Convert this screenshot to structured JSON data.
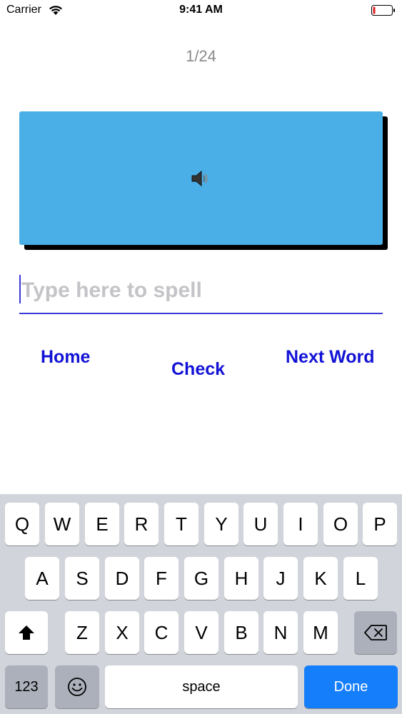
{
  "status_bar": {
    "carrier": "Carrier",
    "time": "9:41 AM",
    "wifi_icon": "wifi-icon",
    "battery_icon": "battery-icon"
  },
  "counter": "1/24",
  "sound_card": {
    "icon": "speaker-icon",
    "color": "#4aafe6"
  },
  "spell_input": {
    "value": "",
    "placeholder": "Type here to spell"
  },
  "buttons": {
    "home": "Home",
    "check": "Check",
    "next_word": "Next Word",
    "color": "#1212d6"
  },
  "keyboard": {
    "row1": [
      "Q",
      "W",
      "E",
      "R",
      "T",
      "Y",
      "U",
      "I",
      "O",
      "P"
    ],
    "row2": [
      "A",
      "S",
      "D",
      "F",
      "G",
      "H",
      "J",
      "K",
      "L"
    ],
    "row3": [
      "Z",
      "X",
      "C",
      "V",
      "B",
      "N",
      "M"
    ],
    "shift_icon": "shift-icon",
    "backspace_icon": "backspace-icon",
    "numbers_label": "123",
    "emoji_icon": "emoji-icon",
    "space_label": "space",
    "done_label": "Done",
    "done_color": "#157efb"
  }
}
